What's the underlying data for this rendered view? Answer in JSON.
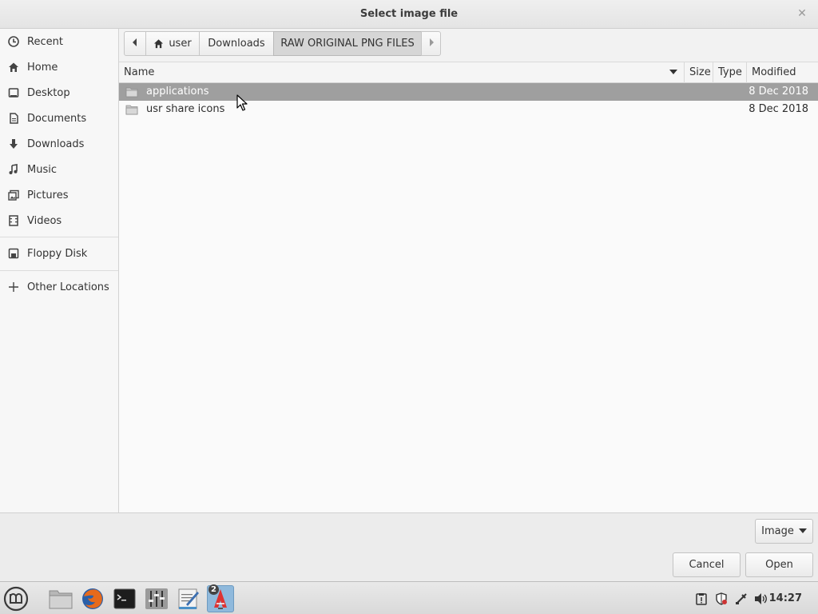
{
  "window": {
    "title": "Select image file"
  },
  "sidebar": {
    "items": [
      {
        "label": "Recent",
        "icon": "clock-icon"
      },
      {
        "label": "Home",
        "icon": "home-icon"
      },
      {
        "label": "Desktop",
        "icon": "desktop-icon"
      },
      {
        "label": "Documents",
        "icon": "document-icon"
      },
      {
        "label": "Downloads",
        "icon": "download-icon"
      },
      {
        "label": "Music",
        "icon": "music-icon"
      },
      {
        "label": "Pictures",
        "icon": "picture-icon"
      },
      {
        "label": "Videos",
        "icon": "video-icon"
      }
    ],
    "devices": [
      {
        "label": "Floppy Disk",
        "icon": "floppy-icon"
      }
    ],
    "other": {
      "label": "Other Locations",
      "icon": "plus-icon"
    }
  },
  "pathbar": {
    "segments": [
      {
        "label": "user",
        "icon": "home-icon"
      },
      {
        "label": "Downloads"
      },
      {
        "label": "RAW ORIGINAL PNG FILES",
        "active": true
      }
    ]
  },
  "filelist": {
    "columns": [
      "Name",
      "Size",
      "Type",
      "Modified"
    ],
    "rows": [
      {
        "name": "applications",
        "modified": "8 Dec 2018",
        "selected": true,
        "icon": "folder-icon"
      },
      {
        "name": "usr share icons",
        "modified": "8 Dec 2018",
        "selected": false,
        "icon": "folder-icon"
      }
    ]
  },
  "actions": {
    "filter_label": "Image",
    "cancel_label": "Cancel",
    "open_label": "Open"
  },
  "taskbar": {
    "apps": [
      "menu-icon",
      "file-manager-icon",
      "firefox-icon",
      "terminal-icon",
      "mixer-icon",
      "text-editor-icon",
      "app-icon"
    ],
    "app_badge": "2",
    "tray": [
      "clipboard-icon",
      "shield-icon",
      "network-icon",
      "volume-icon"
    ],
    "clock": "14:27"
  },
  "colors": {
    "selection": "#9f9f9f",
    "accent": "#4a90c8"
  }
}
